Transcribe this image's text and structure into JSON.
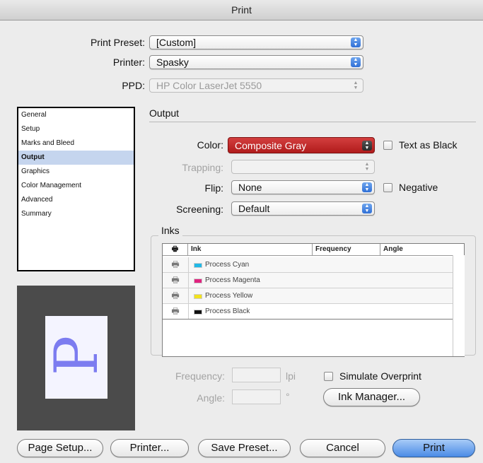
{
  "window": {
    "title": "Print"
  },
  "top": {
    "preset_label": "Print Preset:",
    "preset_value": "[Custom]",
    "printer_label": "Printer:",
    "printer_value": "Spasky",
    "ppd_label": "PPD:",
    "ppd_value": "HP Color LaserJet 5550"
  },
  "sidebar": {
    "items": [
      {
        "label": "General"
      },
      {
        "label": "Setup"
      },
      {
        "label": "Marks and Bleed"
      },
      {
        "label": "Output",
        "selected": true
      },
      {
        "label": "Graphics"
      },
      {
        "label": "Color Management"
      },
      {
        "label": "Advanced"
      },
      {
        "label": "Summary"
      }
    ]
  },
  "preview": {
    "glyph": "P"
  },
  "output": {
    "heading": "Output",
    "color_label": "Color:",
    "color_value": "Composite Gray",
    "text_as_black_label": "Text as Black",
    "trapping_label": "Trapping:",
    "trapping_value": "",
    "flip_label": "Flip:",
    "flip_value": "None",
    "negative_label": "Negative",
    "screening_label": "Screening:",
    "screening_value": "Default"
  },
  "inks": {
    "heading": "Inks",
    "columns": [
      "Ink",
      "Frequency",
      "Angle"
    ],
    "rows": [
      {
        "name": "Process Cyan",
        "color": "#22b8e6"
      },
      {
        "name": "Process Magenta",
        "color": "#e0237f"
      },
      {
        "name": "Process Yellow",
        "color": "#f2e21d"
      },
      {
        "name": "Process Black",
        "color": "#111111"
      }
    ],
    "frequency_label": "Frequency:",
    "frequency_value": "",
    "frequency_unit": "lpi",
    "angle_label": "Angle:",
    "angle_value": "",
    "angle_unit": "°",
    "simulate_overprint_label": "Simulate Overprint",
    "ink_manager_label": "Ink Manager..."
  },
  "buttons": {
    "page_setup": "Page Setup...",
    "printer": "Printer...",
    "save_preset": "Save Preset...",
    "cancel": "Cancel",
    "print": "Print"
  },
  "colors": {
    "accent_red": "#b11b1b",
    "selection": "#c5d5ee",
    "primary_button": "#4a8be6"
  }
}
